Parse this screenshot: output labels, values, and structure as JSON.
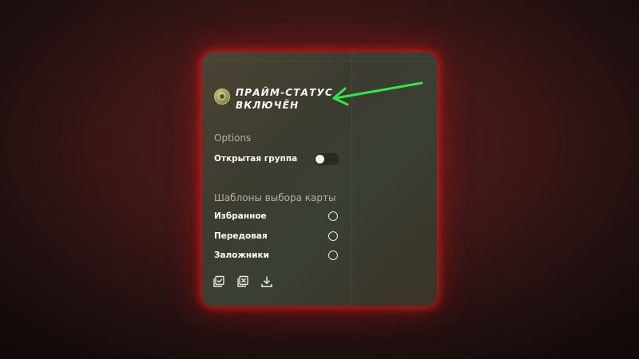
{
  "prime_status": {
    "line1": "ПРАЙМ-СТАТУС",
    "line2": "ВКЛЮЧЁН",
    "icon": "prime-badge-icon"
  },
  "options": {
    "heading": "Options",
    "open_party": {
      "label": "Открытая группа",
      "enabled": false
    }
  },
  "map_templates": {
    "heading": "Шаблоны выбора карты",
    "items": [
      {
        "label": "Избранное",
        "selected": false
      },
      {
        "label": "Передовая",
        "selected": false
      },
      {
        "label": "Заложники",
        "selected": false
      }
    ]
  },
  "toolbar": {
    "icons": [
      "select-all-icon",
      "deselect-all-icon",
      "download-icon"
    ]
  },
  "annotation": {
    "arrow_color": "#2ee84a"
  },
  "colors": {
    "glow": "#d81e1e",
    "background": "#3c1716"
  }
}
